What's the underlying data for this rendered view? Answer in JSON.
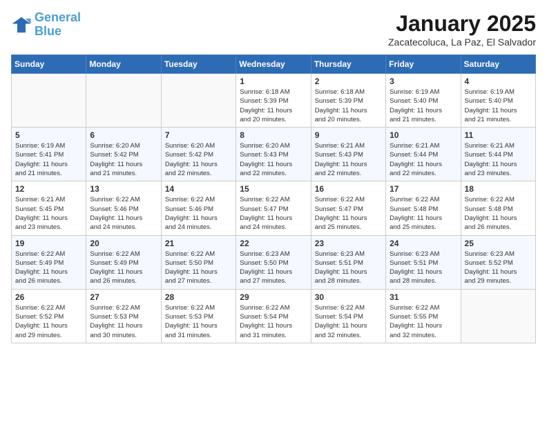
{
  "logo": {
    "line1": "General",
    "line2": "Blue"
  },
  "header": {
    "month": "January 2025",
    "location": "Zacatecoluca, La Paz, El Salvador"
  },
  "weekdays": [
    "Sunday",
    "Monday",
    "Tuesday",
    "Wednesday",
    "Thursday",
    "Friday",
    "Saturday"
  ],
  "weeks": [
    [
      {
        "day": "",
        "info": ""
      },
      {
        "day": "",
        "info": ""
      },
      {
        "day": "",
        "info": ""
      },
      {
        "day": "1",
        "info": "Sunrise: 6:18 AM\nSunset: 5:39 PM\nDaylight: 11 hours\nand 20 minutes."
      },
      {
        "day": "2",
        "info": "Sunrise: 6:18 AM\nSunset: 5:39 PM\nDaylight: 11 hours\nand 20 minutes."
      },
      {
        "day": "3",
        "info": "Sunrise: 6:19 AM\nSunset: 5:40 PM\nDaylight: 11 hours\nand 21 minutes."
      },
      {
        "day": "4",
        "info": "Sunrise: 6:19 AM\nSunset: 5:40 PM\nDaylight: 11 hours\nand 21 minutes."
      }
    ],
    [
      {
        "day": "5",
        "info": "Sunrise: 6:19 AM\nSunset: 5:41 PM\nDaylight: 11 hours\nand 21 minutes."
      },
      {
        "day": "6",
        "info": "Sunrise: 6:20 AM\nSunset: 5:42 PM\nDaylight: 11 hours\nand 21 minutes."
      },
      {
        "day": "7",
        "info": "Sunrise: 6:20 AM\nSunset: 5:42 PM\nDaylight: 11 hours\nand 22 minutes."
      },
      {
        "day": "8",
        "info": "Sunrise: 6:20 AM\nSunset: 5:43 PM\nDaylight: 11 hours\nand 22 minutes."
      },
      {
        "day": "9",
        "info": "Sunrise: 6:21 AM\nSunset: 5:43 PM\nDaylight: 11 hours\nand 22 minutes."
      },
      {
        "day": "10",
        "info": "Sunrise: 6:21 AM\nSunset: 5:44 PM\nDaylight: 11 hours\nand 22 minutes."
      },
      {
        "day": "11",
        "info": "Sunrise: 6:21 AM\nSunset: 5:44 PM\nDaylight: 11 hours\nand 23 minutes."
      }
    ],
    [
      {
        "day": "12",
        "info": "Sunrise: 6:21 AM\nSunset: 5:45 PM\nDaylight: 11 hours\nand 23 minutes."
      },
      {
        "day": "13",
        "info": "Sunrise: 6:22 AM\nSunset: 5:46 PM\nDaylight: 11 hours\nand 24 minutes."
      },
      {
        "day": "14",
        "info": "Sunrise: 6:22 AM\nSunset: 5:46 PM\nDaylight: 11 hours\nand 24 minutes."
      },
      {
        "day": "15",
        "info": "Sunrise: 6:22 AM\nSunset: 5:47 PM\nDaylight: 11 hours\nand 24 minutes."
      },
      {
        "day": "16",
        "info": "Sunrise: 6:22 AM\nSunset: 5:47 PM\nDaylight: 11 hours\nand 25 minutes."
      },
      {
        "day": "17",
        "info": "Sunrise: 6:22 AM\nSunset: 5:48 PM\nDaylight: 11 hours\nand 25 minutes."
      },
      {
        "day": "18",
        "info": "Sunrise: 6:22 AM\nSunset: 5:48 PM\nDaylight: 11 hours\nand 26 minutes."
      }
    ],
    [
      {
        "day": "19",
        "info": "Sunrise: 6:22 AM\nSunset: 5:49 PM\nDaylight: 11 hours\nand 26 minutes."
      },
      {
        "day": "20",
        "info": "Sunrise: 6:22 AM\nSunset: 5:49 PM\nDaylight: 11 hours\nand 26 minutes."
      },
      {
        "day": "21",
        "info": "Sunrise: 6:22 AM\nSunset: 5:50 PM\nDaylight: 11 hours\nand 27 minutes."
      },
      {
        "day": "22",
        "info": "Sunrise: 6:23 AM\nSunset: 5:50 PM\nDaylight: 11 hours\nand 27 minutes."
      },
      {
        "day": "23",
        "info": "Sunrise: 6:23 AM\nSunset: 5:51 PM\nDaylight: 11 hours\nand 28 minutes."
      },
      {
        "day": "24",
        "info": "Sunrise: 6:23 AM\nSunset: 5:51 PM\nDaylight: 11 hours\nand 28 minutes."
      },
      {
        "day": "25",
        "info": "Sunrise: 6:23 AM\nSunset: 5:52 PM\nDaylight: 11 hours\nand 29 minutes."
      }
    ],
    [
      {
        "day": "26",
        "info": "Sunrise: 6:22 AM\nSunset: 5:52 PM\nDaylight: 11 hours\nand 29 minutes."
      },
      {
        "day": "27",
        "info": "Sunrise: 6:22 AM\nSunset: 5:53 PM\nDaylight: 11 hours\nand 30 minutes."
      },
      {
        "day": "28",
        "info": "Sunrise: 6:22 AM\nSunset: 5:53 PM\nDaylight: 11 hours\nand 31 minutes."
      },
      {
        "day": "29",
        "info": "Sunrise: 6:22 AM\nSunset: 5:54 PM\nDaylight: 11 hours\nand 31 minutes."
      },
      {
        "day": "30",
        "info": "Sunrise: 6:22 AM\nSunset: 5:54 PM\nDaylight: 11 hours\nand 32 minutes."
      },
      {
        "day": "31",
        "info": "Sunrise: 6:22 AM\nSunset: 5:55 PM\nDaylight: 11 hours\nand 32 minutes."
      },
      {
        "day": "",
        "info": ""
      }
    ]
  ]
}
